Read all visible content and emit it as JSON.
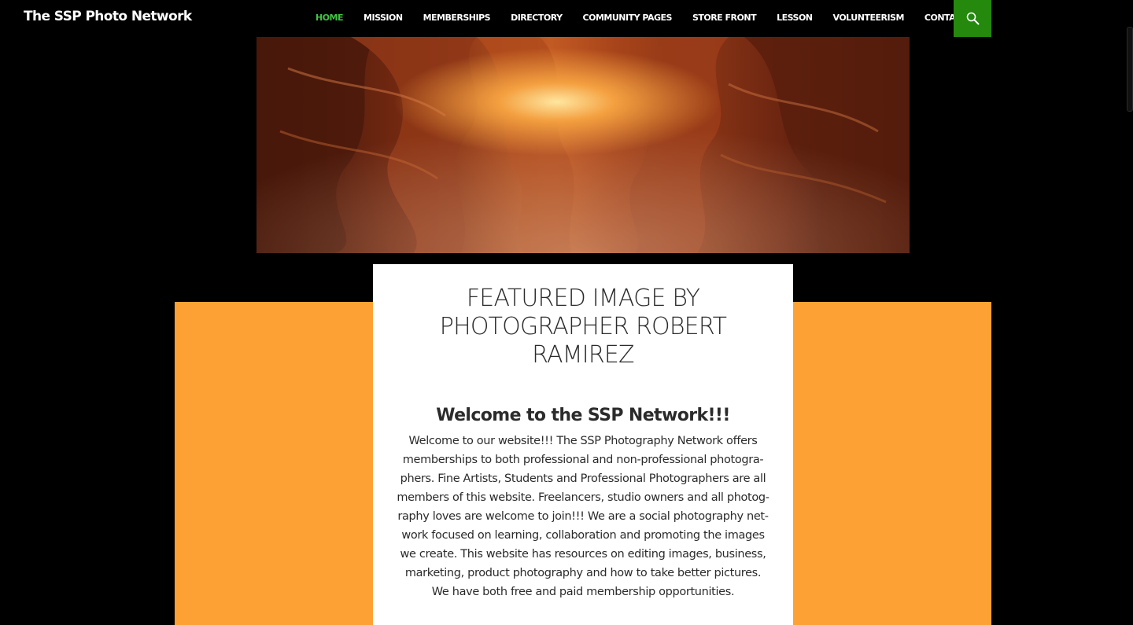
{
  "site": {
    "title": "The SSP Photo Network"
  },
  "nav": {
    "items": [
      {
        "label": "HOME",
        "active": true
      },
      {
        "label": "MISSION"
      },
      {
        "label": "MEMBERSHIPS"
      },
      {
        "label": "DIRECTORY"
      },
      {
        "label": "COMMUNITY PAGES"
      },
      {
        "label": "STORE FRONT"
      },
      {
        "label": "LESSON"
      },
      {
        "label": "VOLUNTEERISM"
      },
      {
        "label": "CONTACT US"
      }
    ],
    "search_icon": "search-icon"
  },
  "hero": {
    "image": "slot-canyon-photo"
  },
  "featured": {
    "title_lines": [
      "FEATURED IMAGE BY",
      "PHOTOGRAPHER ROBERT",
      "RAMIREZ"
    ]
  },
  "welcome": {
    "heading": "Welcome to the SSP Network!!!",
    "lines": [
      "Welcome to our website!!! The SSP Photography Network offers",
      "memberships to both professional and non-professional photogra-",
      "phers. Fine Artists, Students and Professional Photographers are all",
      "members of this website. Freelancers, studio owners and all photog-",
      "raphy loves are welcome to join!!! We are a social photography net-",
      "work focused on learning, collaboration and promoting the images",
      "we create. This website has resources on editing images, business,",
      "marketing, product photography and how to take better pictures.",
      "We have both free and paid membership opportunities."
    ]
  },
  "colors": {
    "accent_green": "#24890d",
    "active_nav": "#41c541",
    "orange_panel": "#fea134",
    "background": "#000000"
  }
}
